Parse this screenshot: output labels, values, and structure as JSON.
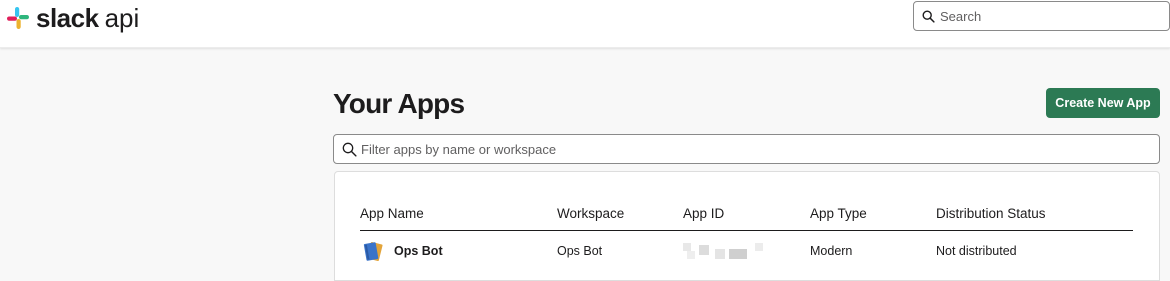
{
  "header": {
    "logo_text": "slack",
    "logo_suffix": "api",
    "search": {
      "placeholder": "Search",
      "value": ""
    }
  },
  "main": {
    "title": "Your Apps",
    "create_button_label": "Create New App",
    "filter": {
      "placeholder": "Filter apps by name or workspace",
      "value": ""
    },
    "table": {
      "columns": [
        "App Name",
        "Workspace",
        "App ID",
        "App Type",
        "Distribution Status"
      ],
      "rows": [
        {
          "app_name": "Ops Bot",
          "icon": "book-icon",
          "workspace": "Ops Bot",
          "app_id": "",
          "app_type": "Modern",
          "distribution_status": "Not distributed"
        }
      ]
    }
  },
  "colors": {
    "accent_green": "#2c7a54",
    "text": "#1d1c1d",
    "page_bg": "#f8f8f8"
  }
}
